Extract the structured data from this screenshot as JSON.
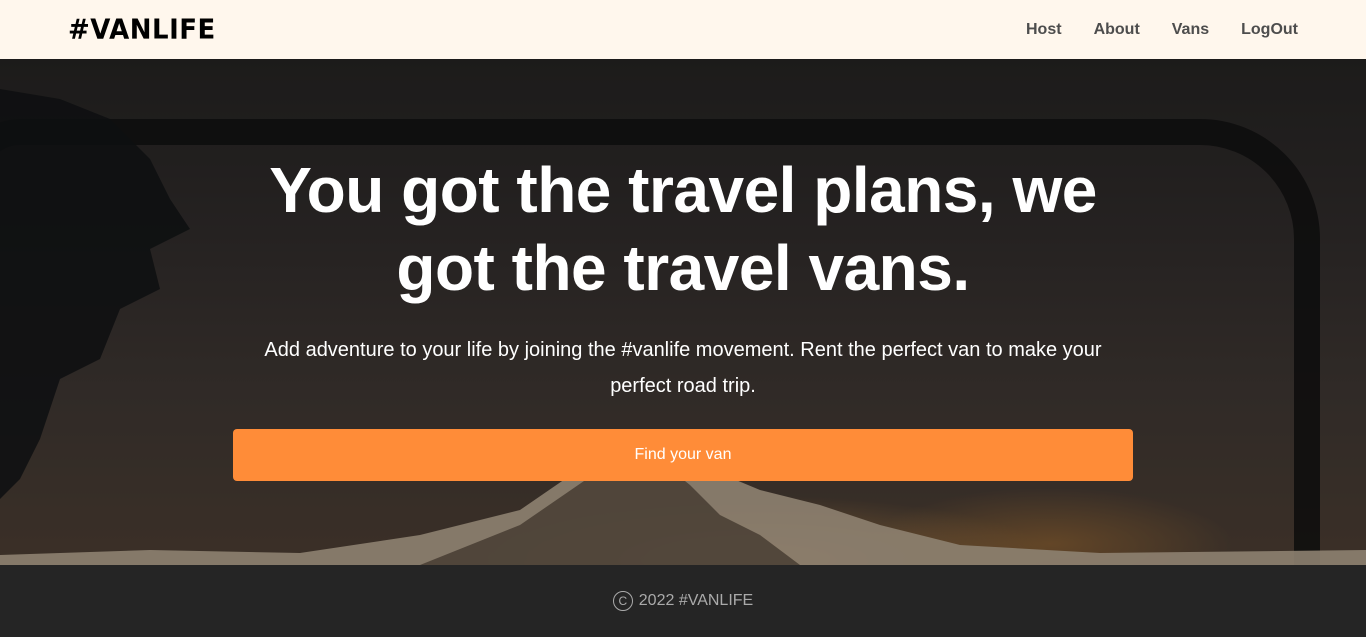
{
  "header": {
    "logo": "#VANLIFE",
    "nav": [
      {
        "label": "Host"
      },
      {
        "label": "About"
      },
      {
        "label": "Vans"
      },
      {
        "label": "LogOut"
      }
    ]
  },
  "hero": {
    "title": "You got the travel plans, we got the travel vans.",
    "subtitle": "Add adventure to your life by joining the #vanlife movement. Rent the perfect van to make your perfect road trip.",
    "cta_label": "Find your van",
    "accent_color": "#FF8C38"
  },
  "footer": {
    "copyright_icon": "copyright-icon",
    "text": "2022 #VANLIFE"
  }
}
